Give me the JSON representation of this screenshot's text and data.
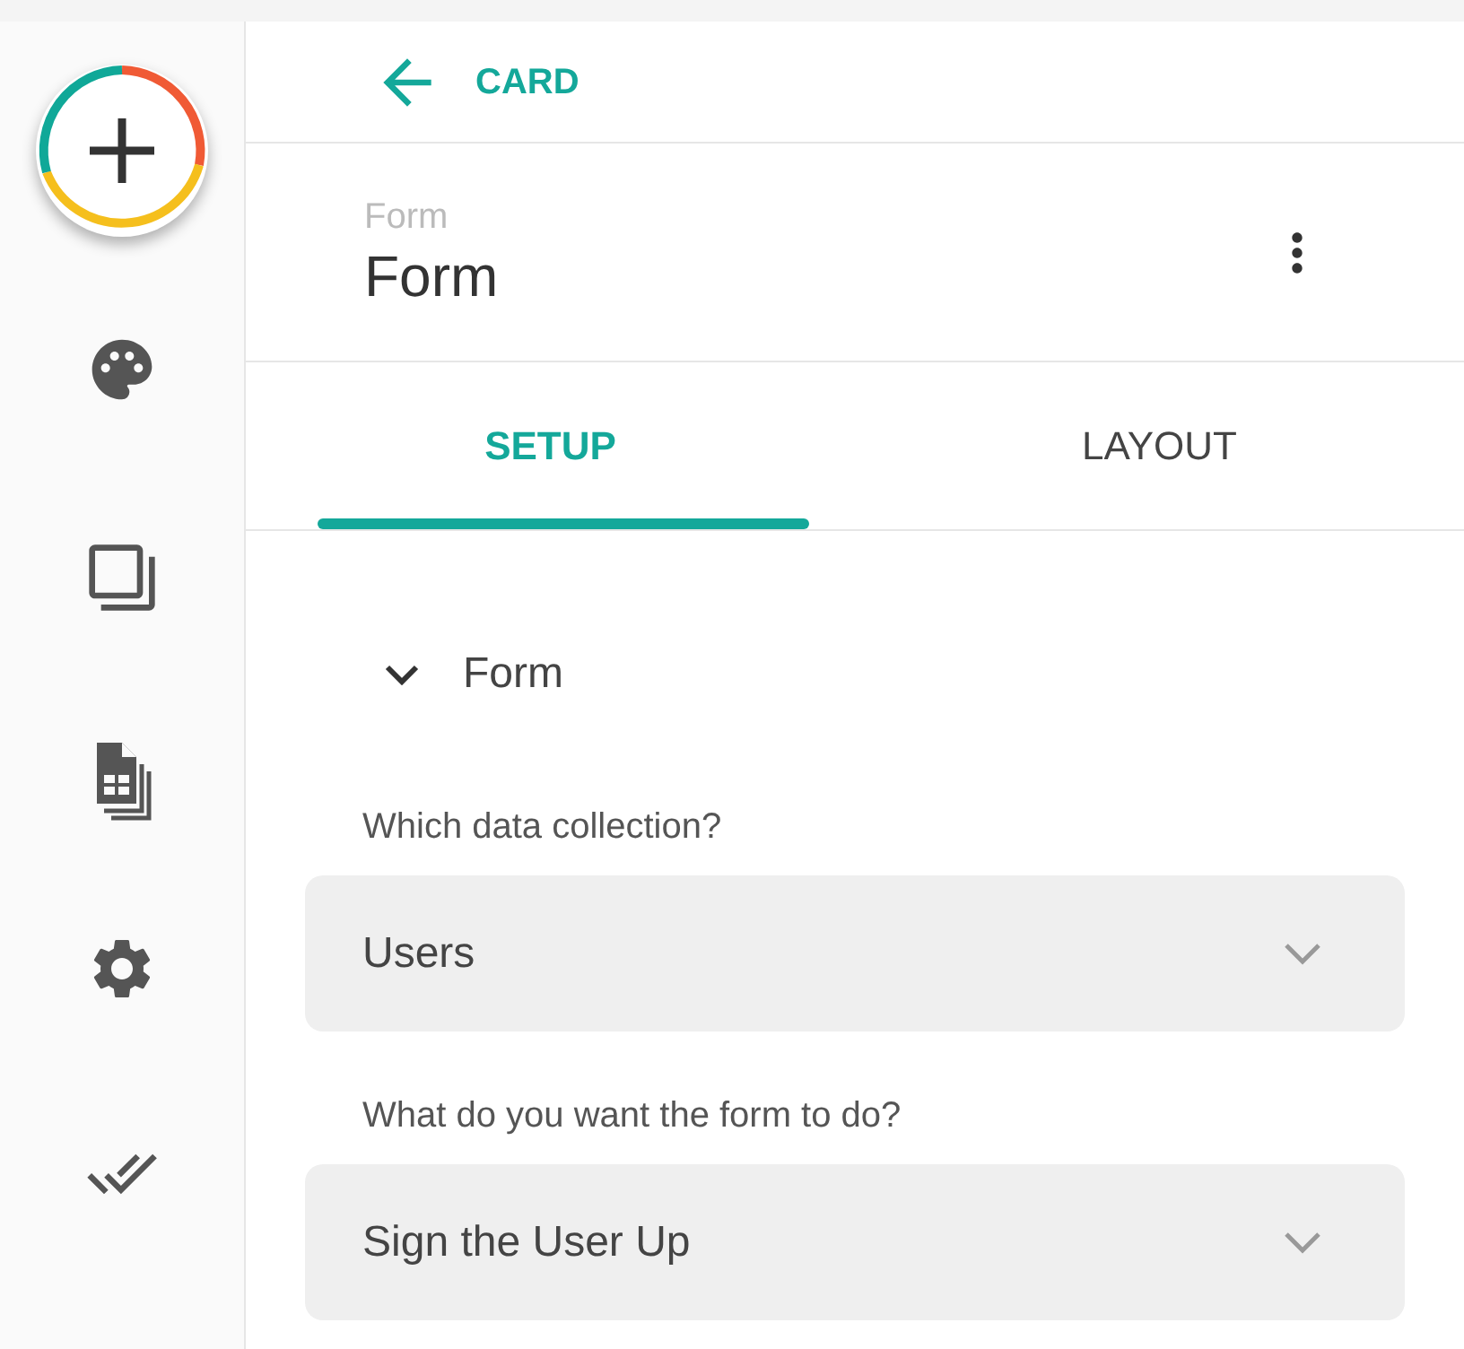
{
  "header": {
    "back_label": "CARD",
    "subtitle": "Form",
    "title": "Form"
  },
  "tabs": [
    {
      "label": "SETUP",
      "selected": true
    },
    {
      "label": "LAYOUT",
      "selected": false
    }
  ],
  "section": {
    "title": "Form",
    "expanded": true,
    "fields": [
      {
        "label": "Which data collection?",
        "value": "Users"
      },
      {
        "label": "What do you want the form to do?",
        "value": "Sign the User Up"
      }
    ]
  }
}
